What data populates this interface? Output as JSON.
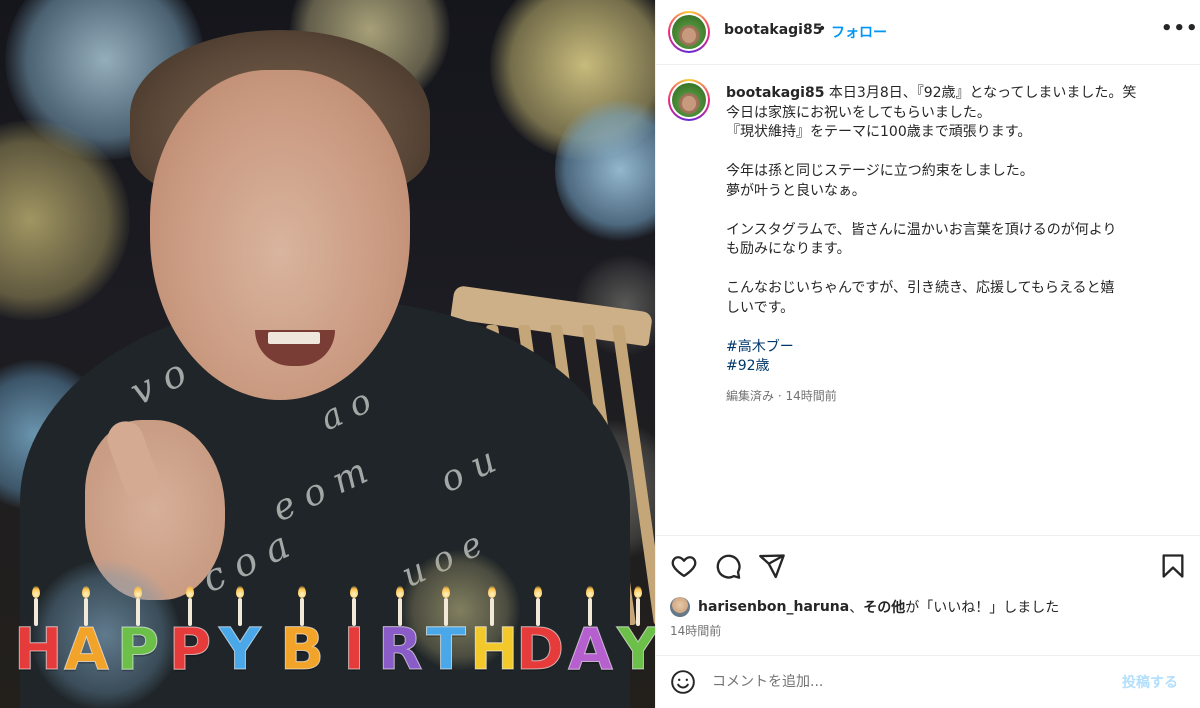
{
  "photo": {
    "overlay_text": "HAPPY BIRTHDAY",
    "letters": [
      {
        "char": "H",
        "color": "#e53b3b"
      },
      {
        "char": "A",
        "color": "#f2a329"
      },
      {
        "char": "P",
        "color": "#6cc04a"
      },
      {
        "char": "P",
        "color": "#e53b3b"
      },
      {
        "char": "Y",
        "color": "#4aa8e8"
      },
      {
        "char": "B",
        "color": "#f2a329"
      },
      {
        "char": "I",
        "color": "#e53b3b"
      },
      {
        "char": "R",
        "color": "#8a5cc8"
      },
      {
        "char": "T",
        "color": "#4aa8e8"
      },
      {
        "char": "H",
        "color": "#f2c82b"
      },
      {
        "char": "D",
        "color": "#e53b3b"
      },
      {
        "char": "A",
        "color": "#b660d0"
      },
      {
        "char": "Y",
        "color": "#6cc04a"
      }
    ]
  },
  "header": {
    "username": "bootakagi85",
    "separator": "•",
    "follow_label": "フォロー",
    "more_icon": "more-horizontal-icon"
  },
  "caption": {
    "username": "bootakagi85",
    "line1": "本日3月8日、『92歳』となってしまいました。笑",
    "line2": "今日は家族にお祝いをしてもらいました。",
    "line3": "『現状維持』をテーマに100歳まで頑張ります。",
    "line4": "今年は孫と同じステージに立つ約束をしました。",
    "line5": "夢が叶うと良いなぁ。",
    "line6": "インスタグラムで、皆さんに温かいお言葉を頂けるのが何より",
    "line7": "も励みになります。",
    "line8": "こんなおじいちゃんですが、引き続き、応援してもらえると嬉",
    "line9": "しいです。",
    "hashtags": [
      "#高木ブー",
      "#92歳"
    ],
    "meta": "編集済み · 14時間前"
  },
  "actions": {
    "icons": [
      "heart-icon",
      "comment-icon",
      "share-icon",
      "bookmark-icon"
    ],
    "likes_user": "harisenbon_haruna",
    "likes_sep": "、",
    "likes_others": "その他",
    "likes_suffix": "が「いいね！」しました",
    "time_ago": "14時間前"
  },
  "comment": {
    "placeholder": "コメントを追加...",
    "post_label": "投稿する",
    "emoji_icon": "emoji-icon"
  },
  "colors": {
    "link_blue": "#0095f6",
    "hashtag": "#00376b",
    "post_disabled": "#b2dffc"
  }
}
